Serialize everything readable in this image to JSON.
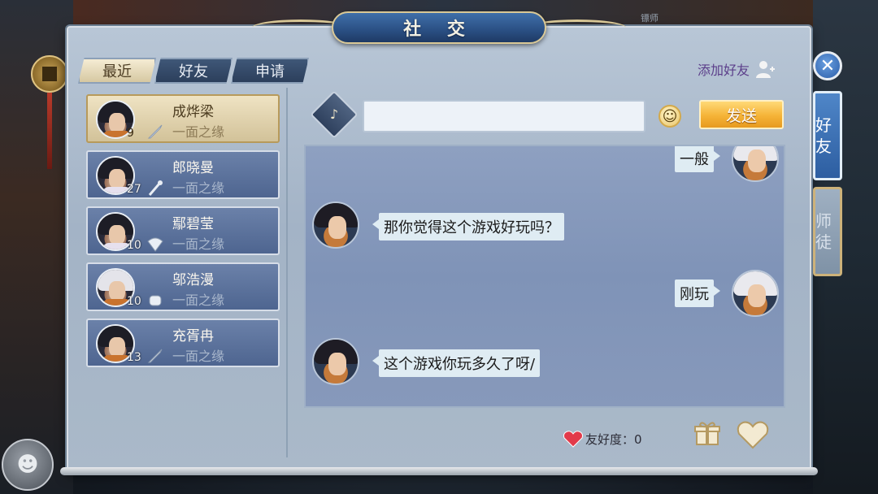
{
  "window": {
    "title": "社 交",
    "top_label": "镖师"
  },
  "tabs": [
    {
      "label": "最近",
      "active": true
    },
    {
      "label": "好友",
      "active": false
    },
    {
      "label": "申请",
      "active": false
    }
  ],
  "add_friend_label": "添加好友",
  "friends": [
    {
      "name": "成烨梁",
      "level": "9",
      "relation": "一面之缘",
      "selected": true
    },
    {
      "name": "郎晓曼",
      "level": "27",
      "relation": "一面之缘",
      "selected": false
    },
    {
      "name": "鄢碧莹",
      "level": "10",
      "relation": "一面之缘",
      "selected": false
    },
    {
      "name": "邬浩漫",
      "level": "10",
      "relation": "一面之缘",
      "selected": false
    },
    {
      "name": "充胥冉",
      "level": "13",
      "relation": "一面之缘",
      "selected": false
    }
  ],
  "chat": {
    "input_value": "",
    "send_label": "发送",
    "messages": [
      {
        "side": "right",
        "text": "一般"
      },
      {
        "side": "left",
        "text": "那你觉得这个游戏好玩吗？"
      },
      {
        "side": "right",
        "text": "刚玩"
      },
      {
        "side": "left",
        "text": "这个游戏你玩多久了呀/"
      }
    ]
  },
  "affinity_label": "友好度：0",
  "side_tabs": [
    {
      "label": "好友",
      "active": true
    },
    {
      "label": "师徒",
      "active": false
    }
  ],
  "colors": {
    "accent_gold": "#f5b337",
    "panel": "#aab9c9",
    "tab_active": "#2d5ea1"
  },
  "icons": [
    "close-icon",
    "add-friend-icon",
    "voice-icon",
    "emoji-icon",
    "gift-icon",
    "heart-icon",
    "sword-class-icon"
  ]
}
